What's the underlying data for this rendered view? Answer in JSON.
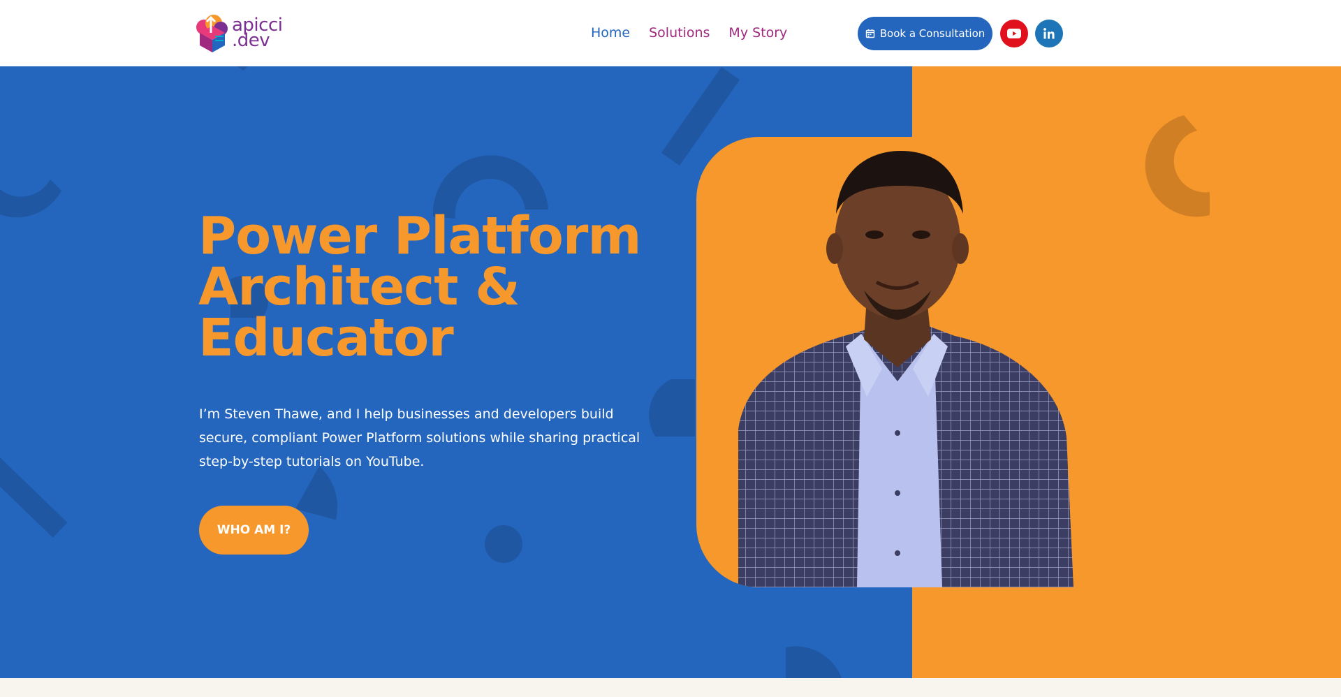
{
  "brand": {
    "logo_line1": "apicci",
    "logo_line2": ".dev",
    "colors": {
      "blue": "#2466bd",
      "orange": "#f7982c",
      "magenta": "#a0287f",
      "youtube": "#e0101c",
      "linkedin": "#1d75b8"
    }
  },
  "nav": {
    "items": [
      {
        "label": "Home",
        "active": true
      },
      {
        "label": "Solutions",
        "active": false
      },
      {
        "label": "My Story",
        "active": false
      }
    ]
  },
  "header_actions": {
    "consult_label": "Book a Consultation",
    "consult_icon": "calendar-icon",
    "youtube_icon": "youtube-icon",
    "linkedin_icon": "linkedin-icon"
  },
  "hero": {
    "title_lines": [
      "Power Platform",
      "Architect &",
      "Educator"
    ],
    "description": "I’m Steven Thawe, and I help businesses and developers build secure, compliant Power Platform solutions while sharing practical step-by-step tutorials on YouTube.",
    "cta_label": "WHO AM I?"
  }
}
